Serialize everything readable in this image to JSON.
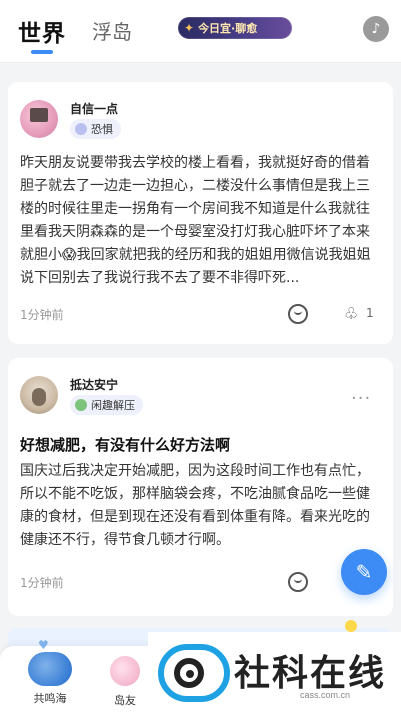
{
  "header": {
    "tabs": [
      {
        "label": "世界",
        "active": true
      },
      {
        "label": "浮岛",
        "active": false
      }
    ],
    "daily_pill": "今日宜·聊愈",
    "accent_color": "#3d8bf5"
  },
  "posts": [
    {
      "username": "自信一点",
      "tag": "恐惧",
      "title": "",
      "body": "昨天朋友说要带我去学校的楼上看看，我就挺好奇的借着胆子就去了一边走一边担心，二楼没什么事情但是我上三楼的时候往里走一拐角有一个房间我不知道是什么我就往里看我天阴森森的是一个母婴室没打灯我心脏吓坏了本来就胆小😱我回家就把我的经历和我的姐姐用微信说我姐姐说下回别去了我说行我不去了要不非得吓死...",
      "time": "1分钟前",
      "like_count": "1"
    },
    {
      "username": "抵达安宁",
      "tag": "闲趣解压",
      "title": "好想减肥，有没有什么好方法啊",
      "body": "国庆过后我决定开始减肥，因为这段时间工作也有点忙，所以不能不吃饭，那样脑袋会疼，不吃油腻食品吃一些健康的食材，但是到现在还没有看到体重有降。看来光吃的健康还不行，得节食几顿才行啊。",
      "time": "1分钟前",
      "more": "···"
    }
  ],
  "fab": {
    "icon": "pen-icon"
  },
  "bottom_nav": [
    {
      "label": "共鸣海",
      "icon": "whale-icon"
    },
    {
      "label": "岛友",
      "icon": "friend-icon"
    }
  ],
  "watermark": {
    "text": "社科在线",
    "sub": "cass.com.cn"
  }
}
